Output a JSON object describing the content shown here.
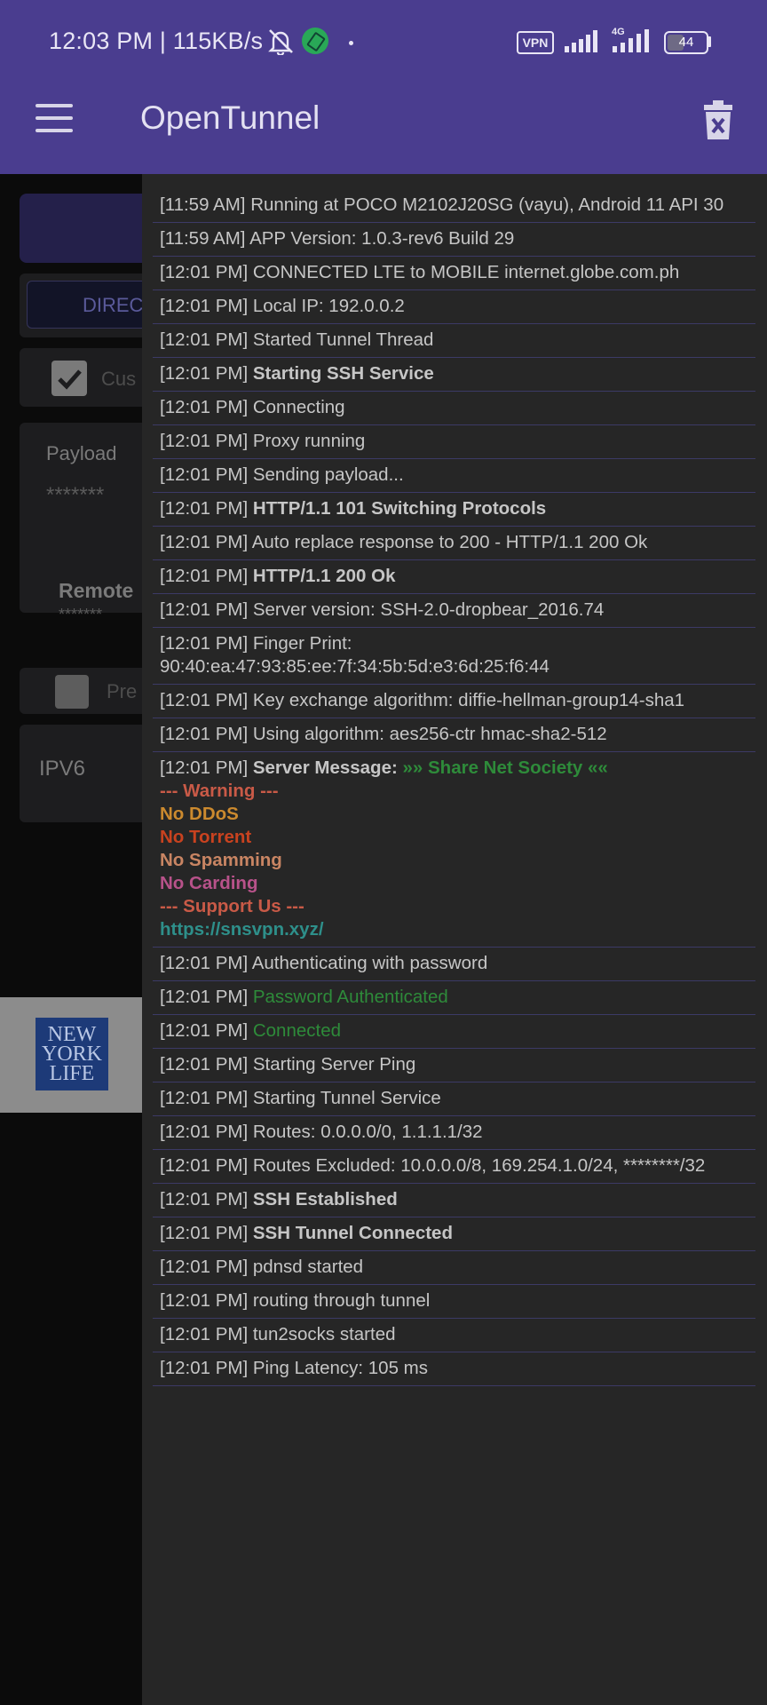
{
  "status_bar": {
    "time": "12:03 PM | 115KB/s",
    "vpn_badge": "VPN",
    "network_type": "4G",
    "battery": "44",
    "battery_level": 0.44
  },
  "app_bar": {
    "title": "OpenTunnel",
    "menu_icon": "hamburger-menu-icon",
    "clear_icon": "trash-icon"
  },
  "background_screen": {
    "direct_tab": "DIRECT",
    "custom_label": "Cus",
    "payload_label": "Payload",
    "payload_value": "*******",
    "remote_label": "Remote",
    "remote_value": "*******",
    "preset_label": "Pre",
    "ipv6_label": "IPV6",
    "ad_logo": "NEW YORK LIFE"
  },
  "log": [
    {
      "time": "[11:59 AM]",
      "text": "Running at POCO M2102J20SG (vayu), Android 11 API 30"
    },
    {
      "time": "[11:59 AM]",
      "text": "APP Version: 1.0.3-rev6 Build 29"
    },
    {
      "time": "[12:01 PM]",
      "text": "CONNECTED LTE to MOBILE internet.globe.com.ph"
    },
    {
      "time": "[12:01 PM]",
      "text": "Local IP: 192.0.0.2"
    },
    {
      "time": "[12:01 PM]",
      "text": "Started Tunnel Thread"
    },
    {
      "time": "[12:01 PM]",
      "text": "Starting SSH Service",
      "bold": true
    },
    {
      "time": "[12:01 PM]",
      "text": "Connecting"
    },
    {
      "time": "[12:01 PM]",
      "text": "Proxy running"
    },
    {
      "time": "[12:01 PM]",
      "text": "Sending payload..."
    },
    {
      "time": "[12:01 PM]",
      "text": "HTTP/1.1 101 Switching Protocols",
      "bold": true
    },
    {
      "time": "[12:01 PM]",
      "text": "Auto replace response to 200 - HTTP/1.1 200 Ok"
    },
    {
      "time": "[12:01 PM]",
      "text": "HTTP/1.1 200 Ok",
      "bold": true
    },
    {
      "time": "[12:01 PM]",
      "text": "Server version: SSH-2.0-dropbear_2016.74"
    },
    {
      "time": "[12:01 PM]",
      "text": "Finger Print:",
      "text2": "90:40:ea:47:93:85:ee:7f:34:5b:5d:e3:6d:25:f6:44"
    },
    {
      "time": "[12:01 PM]",
      "text": "Key exchange algorithm: diffie-hellman-group14-sha1"
    },
    {
      "time": "[12:01 PM]",
      "text": "Using algorithm: aes256-ctr hmac-sha2-512"
    },
    {
      "time": "[12:01 PM]",
      "text": "Server Message:",
      "bold": true,
      "message_title": "»» Share Net Society ««",
      "message_lines": [
        {
          "text": "--- Warning ---",
          "color": "#c95a47"
        },
        {
          "text": "No DDoS",
          "color": "#cc8a2e"
        },
        {
          "text": "No Torrent",
          "color": "#c9421f"
        },
        {
          "text": "No Spamming",
          "color": "#c98563"
        },
        {
          "text": "No Carding",
          "color": "#b8528a"
        },
        {
          "text": "--- Support Us ---",
          "color": "#c95a47"
        },
        {
          "text": "https://snsvpn.xyz/",
          "color": "#2e8f8a"
        }
      ]
    },
    {
      "time": "[12:01 PM]",
      "text": "Authenticating with password"
    },
    {
      "time": "[12:01 PM]",
      "text": "Password Authenticated",
      "color": "#2e8b3a"
    },
    {
      "time": "[12:01 PM]",
      "text": "Connected",
      "color": "#2e8b3a"
    },
    {
      "time": "[12:01 PM]",
      "text": "Starting Server Ping"
    },
    {
      "time": "[12:01 PM]",
      "text": "Starting Tunnel Service"
    },
    {
      "time": "[12:01 PM]",
      "text": "Routes: 0.0.0.0/0, 1.1.1.1/32"
    },
    {
      "time": "[12:01 PM]",
      "text": "Routes Excluded: 10.0.0.0/8, 169.254.1.0/24, ********/32"
    },
    {
      "time": "[12:01 PM]",
      "text": "SSH Established",
      "bold": true
    },
    {
      "time": "[12:01 PM]",
      "text": "SSH Tunnel Connected",
      "bold": true
    },
    {
      "time": "[12:01 PM]",
      "text": "pdnsd started"
    },
    {
      "time": "[12:01 PM]",
      "text": "routing through tunnel"
    },
    {
      "time": "[12:01 PM]",
      "text": "tun2socks started"
    },
    {
      "time": "[12:01 PM]",
      "text": "Ping Latency: 105 ms"
    }
  ]
}
